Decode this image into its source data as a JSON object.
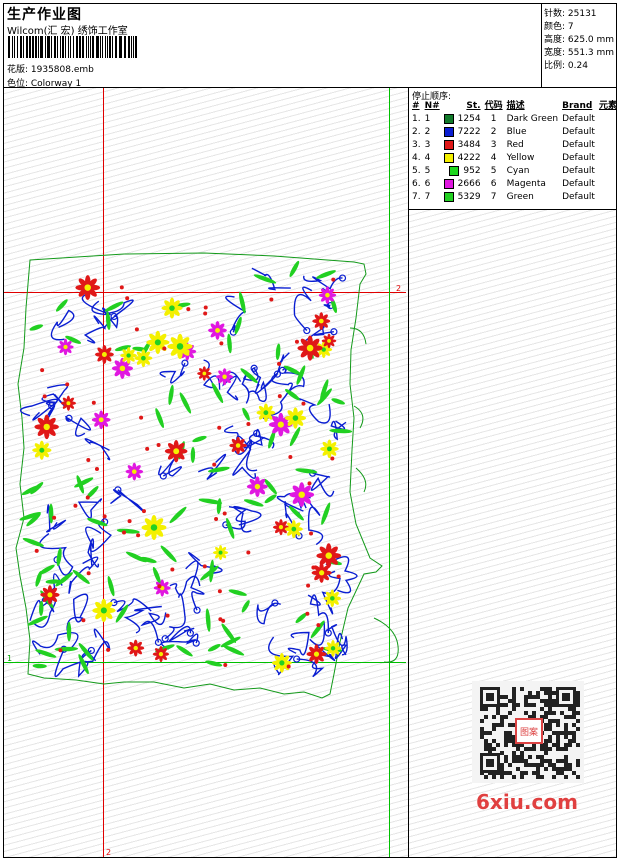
{
  "header": {
    "title": "生产作业图",
    "company": "Wilcom(汇 宏) 绣饰工作室",
    "design_label": "花版: 1935808.emb",
    "colorway_label": "色位: Colorway 1"
  },
  "specs": {
    "stitches": "针数: 25131",
    "colors": "颜色: 7",
    "height": "高度: 625.0 mm",
    "width": "宽度: 551.3 mm",
    "ratio": "比例: 0.24"
  },
  "stop_sequence": {
    "title": "停止顺序:",
    "headers": [
      "#",
      "N#",
      "St.",
      "代码",
      "描述",
      "Brand",
      "元素"
    ],
    "rows": [
      {
        "num": "1.",
        "n": "1",
        "color": "#117a2a",
        "st": "1254",
        "code": "1",
        "desc": "Dark Green",
        "brand": "Default"
      },
      {
        "num": "2.",
        "n": "2",
        "color": "#0a1ed2",
        "st": "7222",
        "code": "2",
        "desc": "Blue",
        "brand": "Default"
      },
      {
        "num": "3.",
        "n": "3",
        "color": "#e01818",
        "st": "3484",
        "code": "3",
        "desc": "Red",
        "brand": "Default"
      },
      {
        "num": "4.",
        "n": "4",
        "color": "#f4f000",
        "st": "4222",
        "code": "4",
        "desc": "Yellow",
        "brand": "Default"
      },
      {
        "num": "5.",
        "n": "5",
        "color": "#1ed81e",
        "st": "952",
        "code": "5",
        "desc": "Cyan",
        "brand": "Default"
      },
      {
        "num": "6.",
        "n": "6",
        "color": "#e018e0",
        "st": "2666",
        "code": "6",
        "desc": "Magenta",
        "brand": "Default"
      },
      {
        "num": "7.",
        "n": "7",
        "color": "#22d022",
        "st": "5329",
        "code": "7",
        "desc": "Green",
        "brand": "Default"
      }
    ]
  },
  "markers": {
    "top_right": "2",
    "left": "1",
    "bottom": "2"
  },
  "watermark": {
    "site": "6xiu.com",
    "seal": "图案"
  }
}
